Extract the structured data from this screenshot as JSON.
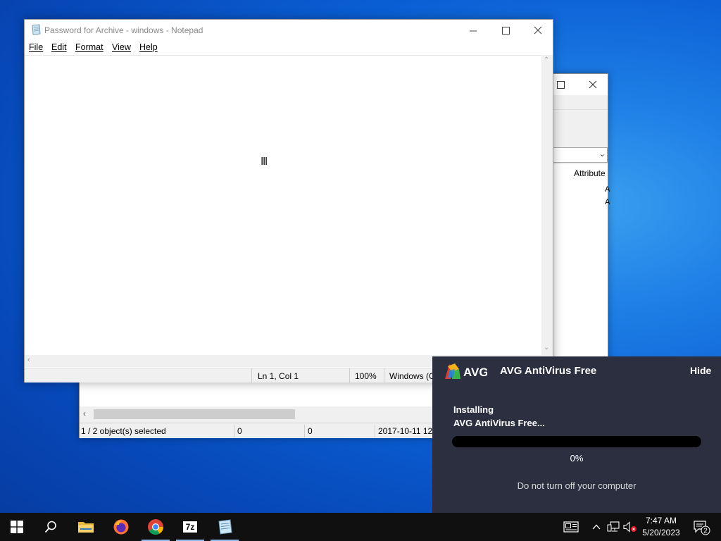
{
  "notepad": {
    "title": "Password for Archive - windows - Notepad",
    "menu": [
      "File",
      "Edit",
      "Format",
      "View",
      "Help"
    ],
    "status": {
      "position": "Ln 1, Col 1",
      "zoom": "100%",
      "encoding": "Windows (C"
    }
  },
  "zip_window": {
    "column_header": "Attribute",
    "status": {
      "selection": "1 / 2 object(s) selected",
      "size": "0",
      "packed": "0",
      "modified": "2017-10-11 12:"
    }
  },
  "avg": {
    "brand": "AVG",
    "title": "AVG AntiVirus Free",
    "hide_label": "Hide",
    "status_line1": "Installing",
    "status_line2": "AVG AntiVirus Free...",
    "progress": 0,
    "percent_label": "0%",
    "warning": "Do not turn off your computer"
  },
  "taskbar": {
    "apps": [
      "start-icon",
      "search-icon",
      "file-explorer-icon",
      "firefox-icon",
      "chrome-icon",
      "7zip-icon",
      "notepad-icon"
    ],
    "seven_zip_label": "7z",
    "clock_time": "7:47 AM",
    "clock_date": "5/20/2023",
    "notification_count": "2"
  },
  "colors": {
    "avg_background": "#2b2f3f",
    "taskbar": "#101010",
    "desktop_accent": "#1f7fe6"
  }
}
